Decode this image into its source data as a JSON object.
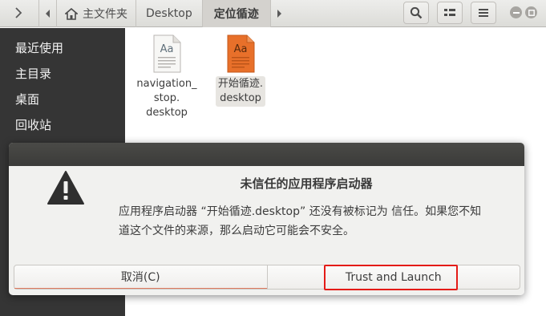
{
  "header": {
    "breadcrumbs": [
      "主文件夹",
      "Desktop",
      "定位循迹"
    ],
    "nav_back_icon": "chevron-left-icon",
    "nav_forward_icon": "chevron-right-icon"
  },
  "sidebar": {
    "items": [
      {
        "label": "最近使用"
      },
      {
        "label": "主目录"
      },
      {
        "label": "桌面"
      },
      {
        "label": "回收站"
      }
    ]
  },
  "files": [
    {
      "label": "navigation_\nstop.\ndesktop",
      "label_lines": [
        "navigation_",
        "stop.",
        "desktop"
      ],
      "icon": "text-document-icon"
    },
    {
      "label_lines": [
        "开始循迹.",
        "desktop"
      ],
      "icon": "font-document-icon",
      "selected": true
    }
  ],
  "dialog": {
    "title": "未信任的应用程序启动器",
    "body_line1": "应用程序启动器 “开始循迹.desktop” 还没有被标记为 信任。如果您不知",
    "body_line2": "道这个文件的来源，那么启动它可能会不安全。",
    "cancel_label": "取消(C)",
    "launch_label": "Trust and Launch"
  },
  "colors": {
    "sidebar_bg": "#353535",
    "accent_highlight": "#e41b17",
    "dialog_title_bg": "#3b3b39"
  }
}
